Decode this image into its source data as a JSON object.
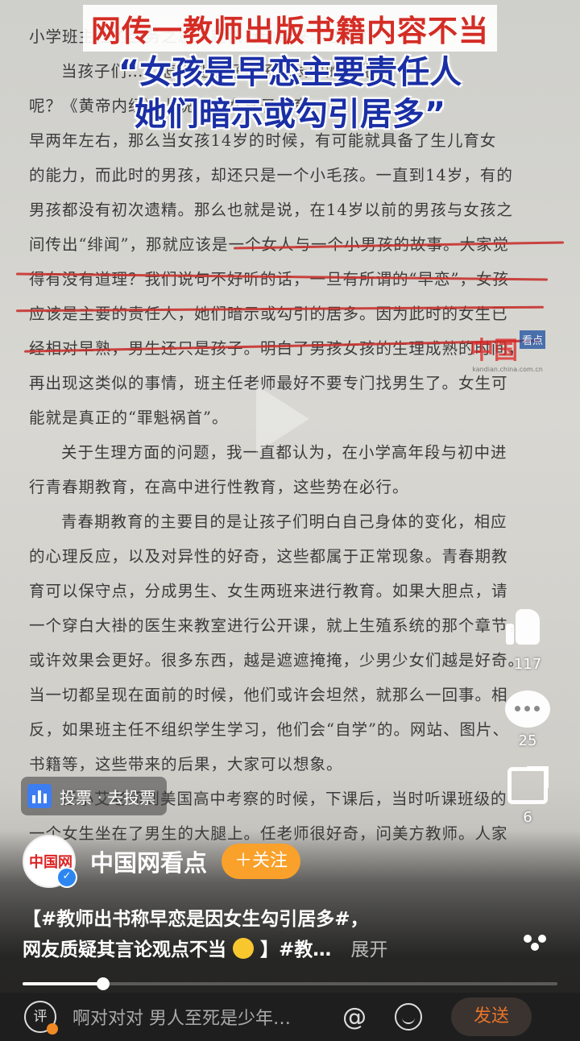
{
  "headline": {
    "line1": "网传一教师出版书籍内容不当",
    "line2": "“女孩是早恋主要责任人",
    "line3": "她们暗示或勾引居多”"
  },
  "book_text": [
    {
      "indent": false,
      "text": "小学班主任的当务之急，赶快行动起来。让我们"
    },
    {
      "indent": true,
      "text": "当孩子们……怎样处理好孩子成长中的变化"
    },
    {
      "indent": false,
      "text": "呢？《黄帝内经》上说……女孩子发育"
    },
    {
      "indent": false,
      "text": "早两年左右，那么当女孩14岁的时候，有可能就具备了生儿育女"
    },
    {
      "indent": false,
      "text": "的能力，而此时的男孩，却还只是一个小毛孩。一直到14岁，有的"
    },
    {
      "indent": false,
      "text": "男孩都没有初次遗精。那么也就是说，在14岁以前的男孩与女孩之"
    },
    {
      "indent": false,
      "text": "间传出“绯闻”，那就应该是一个女人与一个小男孩的故事。大家觉"
    },
    {
      "indent": false,
      "text": "得有没有道理？我们说句不好听的话，一旦有所谓的“早恋”，女孩"
    },
    {
      "indent": false,
      "text": "应该是主要的责任人，她们暗示或勾引的居多。因为此时的女生已"
    },
    {
      "indent": false,
      "text": "经相对早熟，男生还只是孩子。明白了男孩女孩的生理成熟的时间，"
    },
    {
      "indent": false,
      "text": "再出现这类似的事情，班主任老师最好不要专门找男生了。女生可"
    },
    {
      "indent": false,
      "text": "能就是真正的“罪魁祸首”。"
    },
    {
      "indent": true,
      "text": "关于生理方面的问题，我一直都认为，在小学高年段与初中进"
    },
    {
      "indent": false,
      "text": "行青春期教育，在高中进行性教育，这些势在必行。"
    },
    {
      "indent": true,
      "text": "青春期教育的主要目的是让孩子们明白自己身体的变化，相应"
    },
    {
      "indent": false,
      "text": "的心理反应，以及对异性的好奇，这些都属于正常现象。青春期教"
    },
    {
      "indent": false,
      "text": "育可以保守点，分成男生、女生两班来进行教育。如果大胆点，请"
    },
    {
      "indent": false,
      "text": "一个穿白大褂的医生来教室进行公开课，就上生殖系统的那个章节，"
    },
    {
      "indent": false,
      "text": "或许效果会更好。很多东西，越是遮遮掩掩，少男少女们越是好奇。"
    },
    {
      "indent": false,
      "text": "当一切都呈现在面前的时候，他们或许会坦然，就那么一回事。相"
    },
    {
      "indent": false,
      "text": "反，如果班主任不组织学生学习，他们会“自学”的。网站、图片、"
    },
    {
      "indent": false,
      "text": "书籍等，这些带来的后果，大家可以想象。"
    },
    {
      "indent": true,
      "text": "任小艾老师到美国高中考察的时候，下课后，当时听课班级的"
    },
    {
      "indent": false,
      "text": "一个女生坐在了男生的大腿上。任老师很好奇，问美方教师。人家"
    }
  ],
  "watermark": {
    "main": "中国",
    "side": "看点",
    "url": "kandian.china.com.cn"
  },
  "side_rail": {
    "like_count": "117",
    "comment_count": "25",
    "share_count": "6"
  },
  "vote_badge": {
    "label": "投票 · 去投票"
  },
  "author": {
    "avatar_text": "中国网",
    "name": "中国网看点",
    "follow_label": "＋关注"
  },
  "caption": {
    "line1": "【#教师出书称早恋是因女生勾引居多#，",
    "line2": "网友质疑其言论观点不当",
    "line2_tail": "】#教…",
    "expand": "展开"
  },
  "progress": {
    "fraction": 0.15
  },
  "input_bar": {
    "comment_icon_label": "评",
    "placeholder": "啊对对对 男人至死是少年…",
    "at_symbol": "@",
    "send_label": "发送"
  },
  "colors": {
    "headline_red": "#d42c24",
    "headline_blue": "#1a2fa5",
    "follow_orange": "#f9a12a",
    "send_orange": "#e8732a",
    "underline_red": "#c8322d"
  }
}
